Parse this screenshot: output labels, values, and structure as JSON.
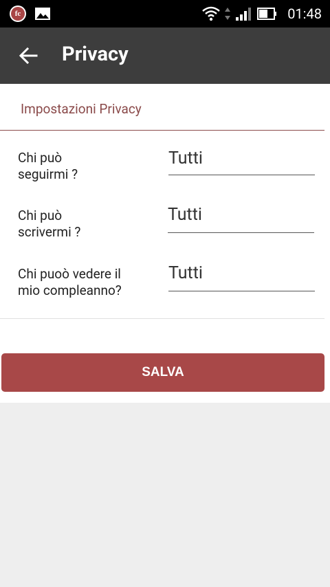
{
  "status_bar": {
    "app_icon_text": "fc",
    "time": "01:48",
    "icons": [
      "fc-app-icon",
      "image-icon",
      "wifi-icon",
      "data-arrows-icon",
      "signal-icon",
      "battery-icon"
    ]
  },
  "app_bar": {
    "title": "Privacy",
    "back_icon": "arrow-left-icon"
  },
  "section": {
    "title": "Impostazioni Privacy"
  },
  "settings": [
    {
      "label_line1": "Chi può",
      "label_line2": "seguirmi ?",
      "value": "Tutti"
    },
    {
      "label_line1": "Chi può",
      "label_line2": "scrivermi ?",
      "value": "Tutti"
    },
    {
      "label_line1": "Chi puoò vedere il",
      "label_line2": "mio compleanno?",
      "value": "Tutti"
    }
  ],
  "save_button": {
    "label": "SALVA"
  },
  "colors": {
    "appbar": "#3d3d3d",
    "accent": "#a84848",
    "section_title": "#8a4a4a"
  }
}
